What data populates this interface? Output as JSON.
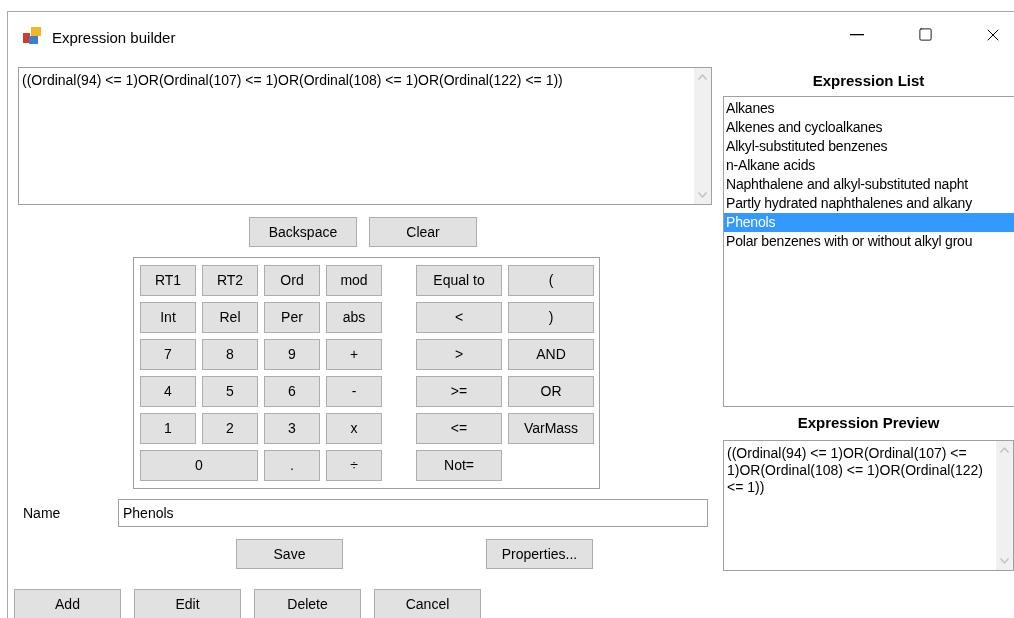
{
  "window": {
    "title": "Expression builder"
  },
  "expression": {
    "value": "((Ordinal(94) <= 1)OR(Ordinal(107) <= 1)OR(Ordinal(108) <= 1)OR(Ordinal(122) <= 1))"
  },
  "edit_buttons": [
    "Backspace",
    "Clear"
  ],
  "keypad": {
    "left": [
      {
        "label": "RT1",
        "kind": "normal"
      },
      {
        "label": "RT2",
        "kind": "normal"
      },
      {
        "label": "Ord",
        "kind": "normal"
      },
      {
        "label": "mod",
        "kind": "normal"
      },
      {
        "label": "Int",
        "kind": "normal"
      },
      {
        "label": "Rel",
        "kind": "normal"
      },
      {
        "label": "Per",
        "kind": "normal"
      },
      {
        "label": "abs",
        "kind": "normal"
      },
      {
        "label": "7",
        "kind": "normal"
      },
      {
        "label": "8",
        "kind": "normal"
      },
      {
        "label": "9",
        "kind": "normal"
      },
      {
        "label": "+",
        "kind": "normal"
      },
      {
        "label": "4",
        "kind": "normal"
      },
      {
        "label": "5",
        "kind": "normal"
      },
      {
        "label": "6",
        "kind": "normal"
      },
      {
        "label": "-",
        "kind": "normal"
      },
      {
        "label": "1",
        "kind": "normal"
      },
      {
        "label": "2",
        "kind": "normal"
      },
      {
        "label": "3",
        "kind": "normal"
      },
      {
        "label": "x",
        "kind": "normal"
      },
      {
        "label": "0",
        "kind": "wide"
      },
      {
        "label": ".",
        "kind": "normal"
      },
      {
        "label": "÷",
        "kind": "normal"
      }
    ],
    "right": [
      "Equal to",
      "(",
      "<",
      ")",
      ">",
      "AND",
      ">=",
      "OR",
      "<=",
      "VarMass",
      "Not="
    ]
  },
  "name_field": {
    "label": "Name",
    "value": "Phenols"
  },
  "form_buttons": [
    "Save",
    "Properties..."
  ],
  "action_buttons": [
    "Add",
    "Edit",
    "Delete",
    "Cancel"
  ],
  "expression_list": {
    "title": "Expression List",
    "items": [
      {
        "label": "Alkanes",
        "selected": false
      },
      {
        "label": "Alkenes and cycloalkanes",
        "selected": false
      },
      {
        "label": "Alkyl-substituted benzenes",
        "selected": false
      },
      {
        "label": "n-Alkane acids",
        "selected": false
      },
      {
        "label": "Naphthalene and alkyl-substituted napht",
        "selected": false
      },
      {
        "label": "Partly hydrated naphthalenes and alkany",
        "selected": false
      },
      {
        "label": "Phenols",
        "selected": true
      },
      {
        "label": "Polar benzenes with or without alkyl grou",
        "selected": false
      }
    ]
  },
  "expression_preview": {
    "title": "Expression Preview",
    "value": "((Ordinal(94) <= 1)OR(Ordinal(107) <= 1)OR(Ordinal(108) <= 1)OR(Ordinal(122) <= 1))"
  }
}
